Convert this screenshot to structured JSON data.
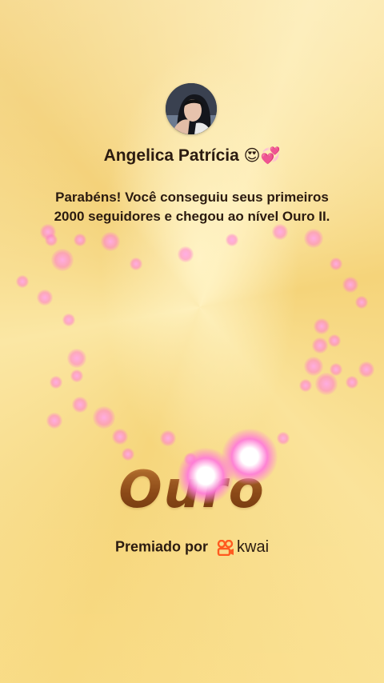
{
  "profile": {
    "name": "Angelica Patrícia",
    "name_emoji": "😍💞",
    "avatar_icon": "profile-photo"
  },
  "message": "Parabéns! Você conseguiu seus primeiros 2000 seguidores e chegou ao nível Ouro II.",
  "level_badge": "Ouro",
  "award": {
    "label": "Premiado por",
    "brand_name": "kwai",
    "brand_icon": "kwai-logo-icon",
    "brand_color": "#ff5a1f"
  },
  "colors": {
    "background": "#f6d67c",
    "text": "#2b1b10",
    "badge": "#8f4c1b",
    "sparkle": "#ff7fd6"
  }
}
